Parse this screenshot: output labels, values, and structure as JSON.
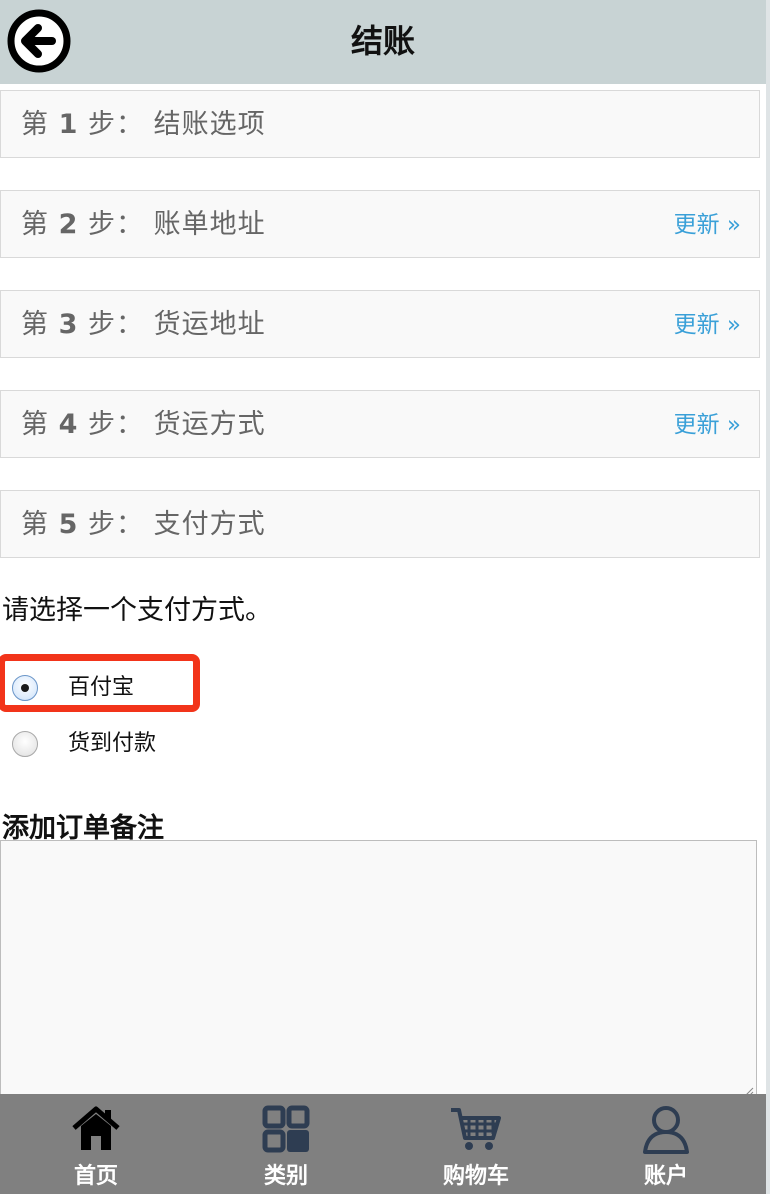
{
  "header": {
    "title": "结账"
  },
  "steps": [
    {
      "prefix": "第 ",
      "num": "1",
      "suffix": " 步：",
      "title": "结账选项",
      "update": ""
    },
    {
      "prefix": "第 ",
      "num": "2",
      "suffix": " 步：",
      "title": "账单地址",
      "update": "更新 »"
    },
    {
      "prefix": "第 ",
      "num": "3",
      "suffix": " 步：",
      "title": "货运地址",
      "update": "更新 »"
    },
    {
      "prefix": "第 ",
      "num": "4",
      "suffix": " 步：",
      "title": "货运方式",
      "update": "更新 »"
    },
    {
      "prefix": "第 ",
      "num": "5",
      "suffix": " 步：",
      "title": "支付方式",
      "update": ""
    }
  ],
  "payment": {
    "prompt": "请选择一个支付方式。",
    "options": [
      {
        "label": "百付宝",
        "selected": true
      },
      {
        "label": "货到付款",
        "selected": false
      }
    ]
  },
  "notes": {
    "label": "添加订单备注",
    "value": ""
  },
  "tabbar": {
    "items": [
      {
        "label": "首页",
        "icon": "home-icon"
      },
      {
        "label": "类别",
        "icon": "grid-icon"
      },
      {
        "label": "购物车",
        "icon": "cart-icon"
      },
      {
        "label": "账户",
        "icon": "user-icon"
      }
    ]
  },
  "colors": {
    "header_bg": "#c8d3d4",
    "link": "#3aa0d8",
    "highlight": "#f2341a",
    "tabbar_bg": "#808080",
    "tab_icon": "#2e3d52"
  }
}
